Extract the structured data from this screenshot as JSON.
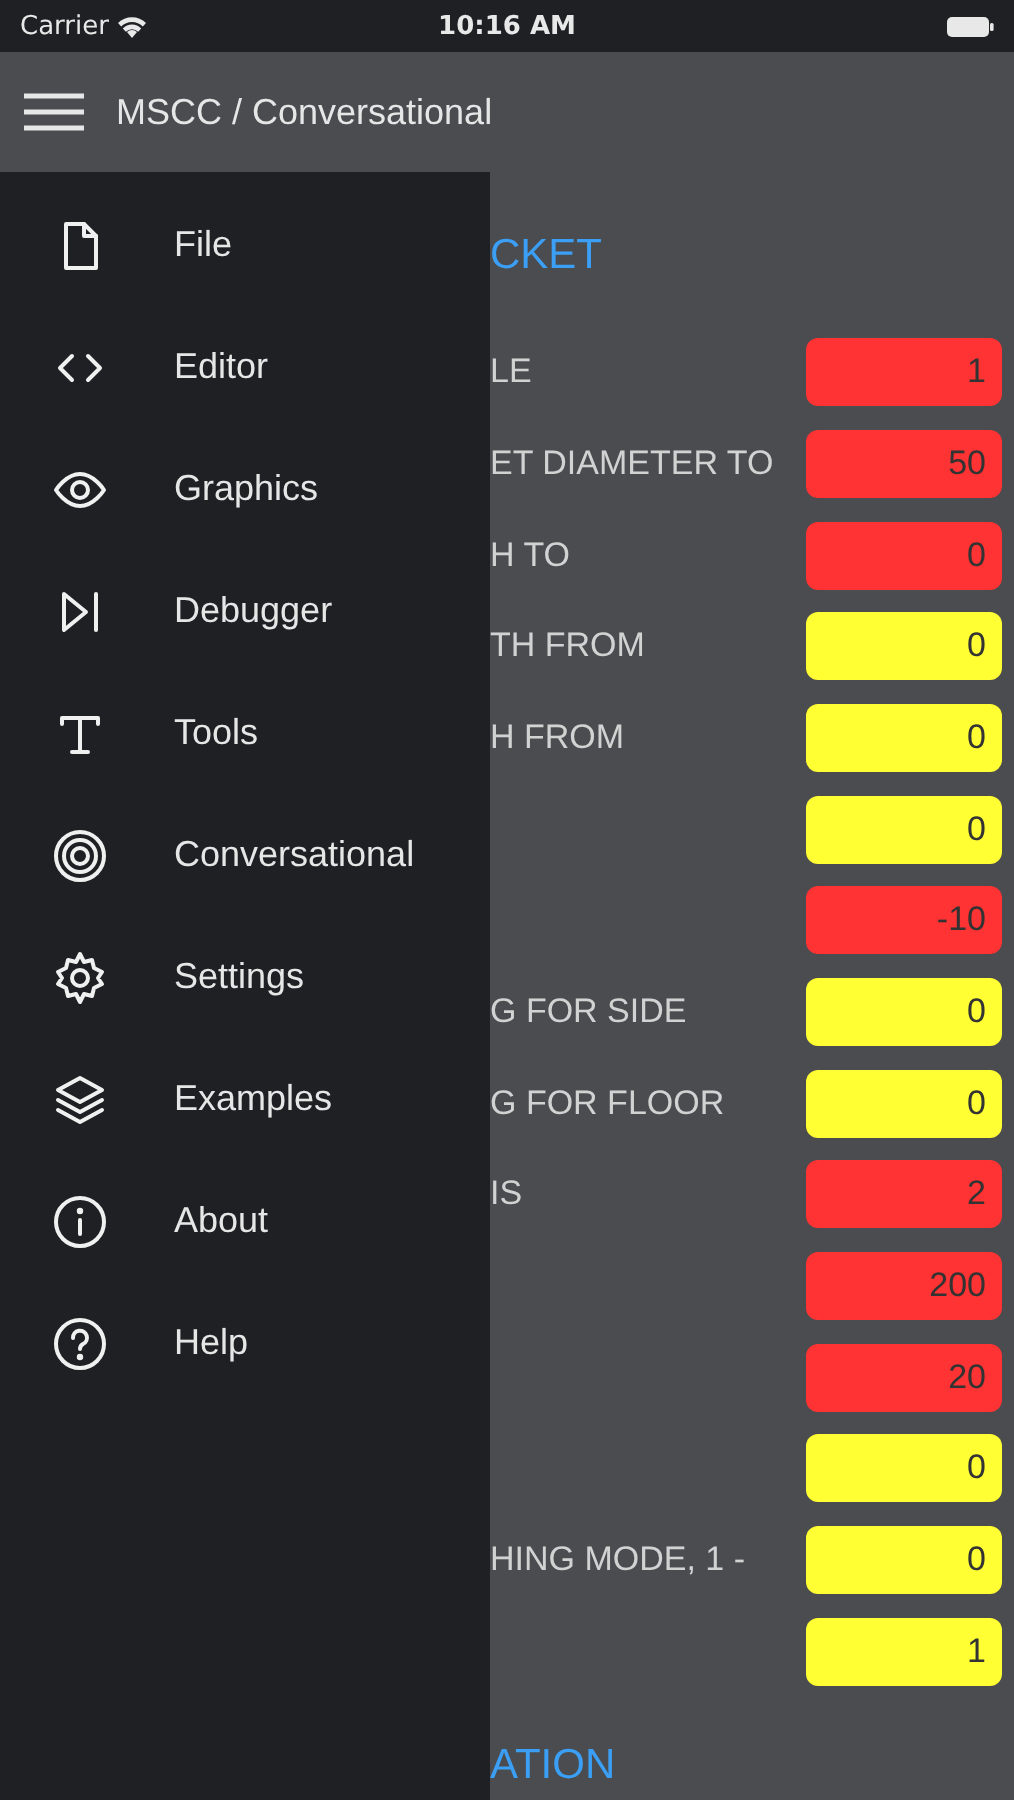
{
  "status_bar": {
    "carrier": "Carrier",
    "time": "10:16 AM"
  },
  "header": {
    "title": "MSCC / Conversational"
  },
  "drawer": {
    "items": [
      {
        "kind": "file",
        "label": "File"
      },
      {
        "kind": "code",
        "label": "Editor"
      },
      {
        "kind": "eye",
        "label": "Graphics"
      },
      {
        "kind": "debug",
        "label": "Debugger"
      },
      {
        "kind": "text",
        "label": "Tools"
      },
      {
        "kind": "target",
        "label": "Conversational"
      },
      {
        "kind": "gear",
        "label": "Settings"
      },
      {
        "kind": "layers",
        "label": "Examples"
      },
      {
        "kind": "info",
        "label": "About"
      },
      {
        "kind": "help",
        "label": "Help"
      }
    ]
  },
  "content": {
    "section_title": "CKET",
    "rows": [
      {
        "label": "LE",
        "value": "1",
        "color": "#ff3333"
      },
      {
        "label": "ET DIAMETER TO",
        "value": "50",
        "color": "#ff3333"
      },
      {
        "label": "H TO",
        "value": "0",
        "color": "#ff3333"
      },
      {
        "label": "TH FROM",
        "value": "0",
        "color": "#ffff33"
      },
      {
        "label": "H FROM",
        "value": "0",
        "color": "#ffff33"
      },
      {
        "value": "0",
        "color": "#ffff33"
      },
      {
        "value": "-10",
        "color": "#ff3333"
      },
      {
        "label": "G FOR SIDE",
        "value": "0",
        "color": "#ffff33"
      },
      {
        "label": "G FOR FLOOR",
        "value": "0",
        "color": "#ffff33"
      },
      {
        "label": "IS",
        "value": "2",
        "color": "#ff3333"
      },
      {
        "value": "200",
        "color": "#ff3333"
      },
      {
        "value": "20",
        "color": "#ff3333"
      },
      {
        "value": "0",
        "color": "#ffff33"
      },
      {
        "label": "HING MODE, 1 -",
        "value": "0",
        "color": "#ffff33"
      },
      {
        "value": "1",
        "color": "#ffff33"
      }
    ],
    "next_section_title": "ATION"
  }
}
